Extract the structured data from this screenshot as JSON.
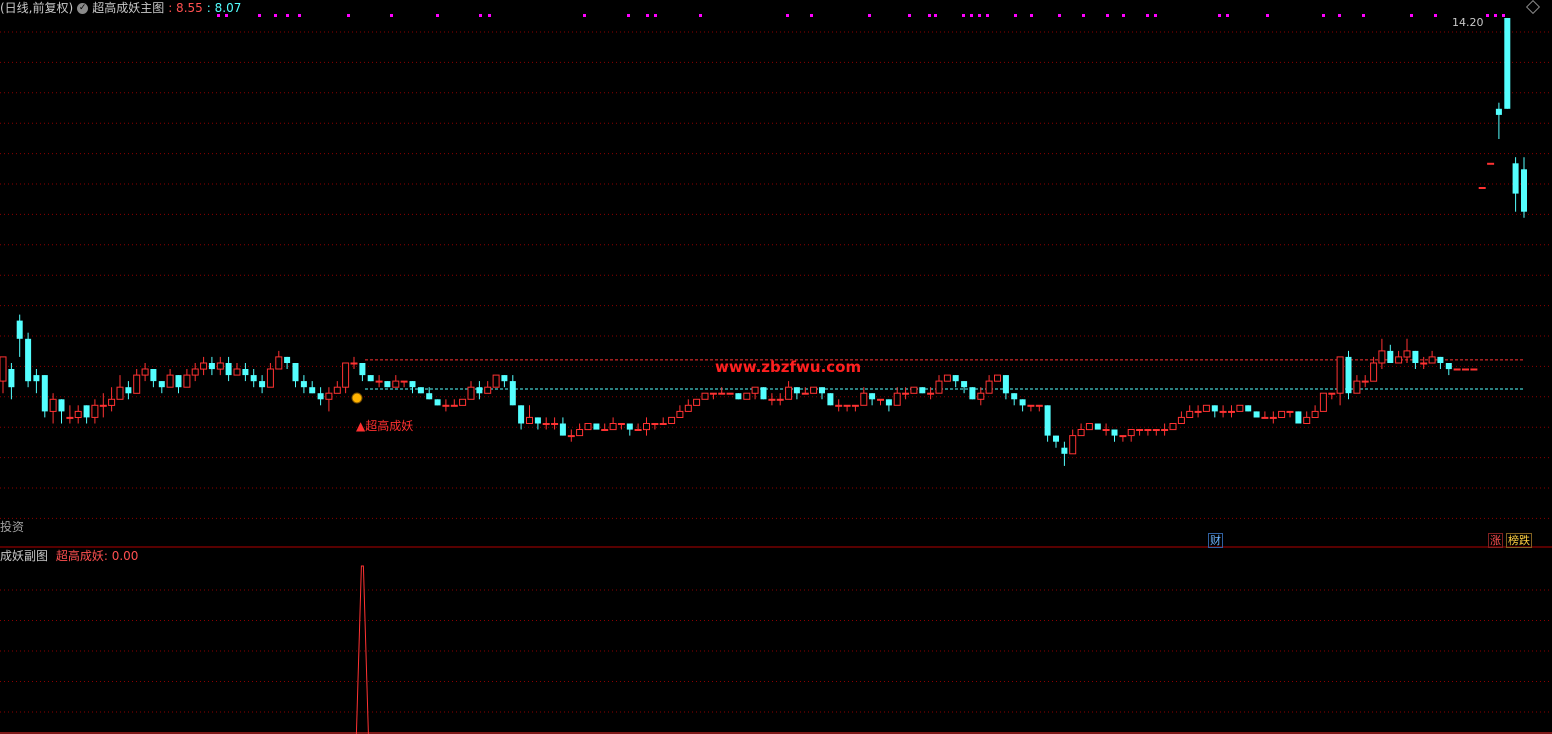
{
  "header": {
    "period_label": "(日线,前复权)",
    "main_name": "超高成妖主图",
    "value_a": ": 8.55",
    "value_b": ": 8.07"
  },
  "sub_header": {
    "name": "成妖副图",
    "indicator_label": "超高成妖",
    "indicator_value": ": 0.00"
  },
  "labels": {
    "price_high": "14.20",
    "watermark": "www.zbzfwu.com",
    "signal": "▲超高成妖",
    "left_text": "投资",
    "cai": "财",
    "zhang": "涨",
    "bang_die": "榜跌"
  },
  "colors": {
    "up": "#ff3232",
    "down": "#54ffff",
    "grid": "#8b0000",
    "magenta": "#ff00ff",
    "watermark": "#ff2020",
    "signal": "#ff3030"
  },
  "chart_data": {
    "type": "candlestick",
    "note_series": "ohlc price units",
    "candles": [
      [
        8.2,
        8.6,
        8.0,
        8.4
      ],
      [
        8.4,
        8.1,
        7.9,
        8.5
      ],
      [
        9.2,
        8.9,
        8.6,
        9.3
      ],
      [
        8.9,
        8.2,
        8.1,
        9.0
      ],
      [
        8.3,
        8.2,
        8.0,
        8.4
      ],
      [
        8.3,
        7.7,
        7.6,
        8.3
      ],
      [
        7.7,
        7.9,
        7.5,
        8.0
      ],
      [
        7.9,
        7.7,
        7.5,
        7.9
      ],
      [
        7.6,
        7.6,
        7.5,
        7.8
      ],
      [
        7.6,
        7.7,
        7.5,
        7.8
      ],
      [
        7.8,
        7.6,
        7.5,
        7.8
      ],
      [
        7.6,
        7.8,
        7.5,
        7.9
      ],
      [
        7.8,
        7.8,
        7.6,
        8.0
      ],
      [
        7.8,
        7.9,
        7.7,
        8.1
      ],
      [
        7.9,
        8.1,
        7.9,
        8.3
      ],
      [
        8.1,
        8.0,
        7.9,
        8.2
      ],
      [
        8.0,
        8.3,
        8.0,
        8.4
      ],
      [
        8.3,
        8.4,
        8.2,
        8.5
      ],
      [
        8.4,
        8.2,
        8.1,
        8.4
      ],
      [
        8.2,
        8.1,
        8.0,
        8.2
      ],
      [
        8.1,
        8.3,
        8.1,
        8.4
      ],
      [
        8.3,
        8.1,
        8.0,
        8.3
      ],
      [
        8.1,
        8.3,
        8.1,
        8.4
      ],
      [
        8.3,
        8.4,
        8.2,
        8.5
      ],
      [
        8.4,
        8.5,
        8.3,
        8.6
      ],
      [
        8.5,
        8.4,
        8.3,
        8.6
      ],
      [
        8.4,
        8.5,
        8.3,
        8.6
      ],
      [
        8.5,
        8.3,
        8.2,
        8.6
      ],
      [
        8.3,
        8.4,
        8.3,
        8.5
      ],
      [
        8.4,
        8.3,
        8.2,
        8.5
      ],
      [
        8.3,
        8.2,
        8.1,
        8.4
      ],
      [
        8.2,
        8.1,
        8.0,
        8.3
      ],
      [
        8.1,
        8.4,
        8.1,
        8.5
      ],
      [
        8.4,
        8.6,
        8.4,
        8.7
      ],
      [
        8.6,
        8.5,
        8.4,
        8.6
      ],
      [
        8.5,
        8.2,
        8.1,
        8.5
      ],
      [
        8.2,
        8.1,
        8.0,
        8.3
      ],
      [
        8.1,
        8.0,
        8.0,
        8.2
      ],
      [
        8.0,
        7.9,
        7.8,
        8.1
      ],
      [
        7.9,
        8.0,
        7.7,
        8.1
      ],
      [
        8.0,
        8.1,
        8.0,
        8.2
      ],
      [
        8.1,
        8.5,
        8.0,
        8.5
      ],
      [
        8.5,
        8.5,
        8.4,
        8.6
      ],
      [
        8.5,
        8.3,
        8.2,
        8.5
      ],
      [
        8.3,
        8.2,
        8.2,
        8.3
      ],
      [
        8.2,
        8.2,
        8.1,
        8.3
      ],
      [
        8.2,
        8.1,
        8.1,
        8.2
      ],
      [
        8.1,
        8.2,
        8.1,
        8.3
      ],
      [
        8.2,
        8.2,
        8.1,
        8.2
      ],
      [
        8.2,
        8.1,
        8.0,
        8.2
      ],
      [
        8.1,
        8.0,
        8.0,
        8.1
      ],
      [
        8.0,
        7.9,
        7.9,
        8.1
      ],
      [
        7.9,
        7.8,
        7.8,
        7.9
      ],
      [
        7.8,
        7.8,
        7.7,
        7.9
      ],
      [
        7.8,
        7.8,
        7.8,
        7.9
      ],
      [
        7.8,
        7.9,
        7.8,
        7.9
      ],
      [
        7.9,
        8.1,
        7.9,
        8.2
      ],
      [
        8.1,
        8.0,
        7.9,
        8.2
      ],
      [
        8.0,
        8.1,
        8.0,
        8.2
      ],
      [
        8.1,
        8.3,
        8.1,
        8.3
      ],
      [
        8.3,
        8.2,
        8.1,
        8.3
      ],
      [
        8.2,
        7.8,
        7.8,
        8.3
      ],
      [
        7.8,
        7.5,
        7.4,
        7.8
      ],
      [
        7.5,
        7.6,
        7.5,
        7.8
      ],
      [
        7.6,
        7.5,
        7.4,
        7.6
      ],
      [
        7.5,
        7.5,
        7.4,
        7.6
      ],
      [
        7.5,
        7.5,
        7.4,
        7.6
      ],
      [
        7.5,
        7.3,
        7.3,
        7.6
      ],
      [
        7.3,
        7.3,
        7.2,
        7.4
      ],
      [
        7.3,
        7.4,
        7.3,
        7.5
      ],
      [
        7.4,
        7.5,
        7.4,
        7.5
      ],
      [
        7.5,
        7.4,
        7.4,
        7.5
      ],
      [
        7.4,
        7.4,
        7.4,
        7.5
      ],
      [
        7.4,
        7.5,
        7.4,
        7.6
      ],
      [
        7.5,
        7.5,
        7.4,
        7.5
      ],
      [
        7.5,
        7.4,
        7.3,
        7.5
      ],
      [
        7.4,
        7.4,
        7.4,
        7.5
      ],
      [
        7.4,
        7.5,
        7.3,
        7.6
      ],
      [
        7.5,
        7.5,
        7.4,
        7.5
      ],
      [
        7.5,
        7.5,
        7.5,
        7.6
      ],
      [
        7.5,
        7.6,
        7.5,
        7.6
      ],
      [
        7.6,
        7.7,
        7.6,
        7.8
      ],
      [
        7.7,
        7.8,
        7.7,
        7.9
      ],
      [
        7.8,
        7.9,
        7.8,
        7.9
      ],
      [
        7.9,
        8.0,
        7.9,
        8.0
      ],
      [
        8.0,
        8.0,
        7.9,
        8.0
      ],
      [
        8.0,
        8.0,
        8.0,
        8.1
      ],
      [
        8.0,
        8.0,
        8.0,
        8.0
      ],
      [
        8.0,
        7.9,
        7.9,
        8.0
      ],
      [
        7.9,
        8.0,
        7.9,
        8.0
      ],
      [
        8.0,
        8.1,
        7.9,
        8.1
      ],
      [
        8.1,
        7.9,
        7.9,
        8.1
      ],
      [
        7.9,
        7.9,
        7.8,
        8.0
      ],
      [
        7.9,
        7.9,
        7.8,
        8.0
      ],
      [
        7.9,
        8.1,
        7.9,
        8.2
      ],
      [
        8.1,
        8.0,
        7.9,
        8.1
      ],
      [
        8.0,
        8.0,
        8.0,
        8.1
      ],
      [
        8.0,
        8.1,
        8.0,
        8.1
      ],
      [
        8.1,
        8.0,
        7.9,
        8.1
      ],
      [
        8.0,
        7.8,
        7.8,
        8.0
      ],
      [
        7.8,
        7.8,
        7.7,
        7.9
      ],
      [
        7.8,
        7.8,
        7.7,
        7.8
      ],
      [
        7.8,
        7.8,
        7.7,
        7.8
      ],
      [
        7.8,
        8.0,
        7.8,
        8.1
      ],
      [
        8.0,
        7.9,
        7.8,
        8.0
      ],
      [
        7.9,
        7.9,
        7.8,
        7.9
      ],
      [
        7.9,
        7.8,
        7.7,
        7.9
      ],
      [
        7.8,
        8.0,
        7.8,
        8.1
      ],
      [
        8.0,
        8.0,
        7.9,
        8.1
      ],
      [
        8.0,
        8.1,
        8.0,
        8.1
      ],
      [
        8.1,
        8.0,
        8.0,
        8.1
      ],
      [
        8.0,
        8.0,
        7.9,
        8.1
      ],
      [
        8.0,
        8.2,
        8.0,
        8.3
      ],
      [
        8.2,
        8.3,
        8.2,
        8.3
      ],
      [
        8.3,
        8.2,
        8.1,
        8.3
      ],
      [
        8.2,
        8.1,
        8.0,
        8.2
      ],
      [
        8.1,
        7.9,
        7.9,
        8.1
      ],
      [
        7.9,
        8.0,
        7.8,
        8.1
      ],
      [
        8.0,
        8.2,
        8.0,
        8.3
      ],
      [
        8.2,
        8.3,
        8.2,
        8.3
      ],
      [
        8.3,
        8.0,
        7.9,
        8.3
      ],
      [
        8.0,
        7.9,
        7.8,
        8.0
      ],
      [
        7.9,
        7.8,
        7.7,
        7.9
      ],
      [
        7.8,
        7.8,
        7.7,
        7.8
      ],
      [
        7.8,
        7.8,
        7.7,
        7.8
      ],
      [
        7.8,
        7.3,
        7.2,
        7.8
      ],
      [
        7.3,
        7.2,
        7.1,
        7.3
      ],
      [
        7.1,
        7.0,
        6.8,
        7.2
      ],
      [
        7.0,
        7.3,
        7.0,
        7.4
      ],
      [
        7.3,
        7.4,
        7.3,
        7.5
      ],
      [
        7.4,
        7.5,
        7.4,
        7.5
      ],
      [
        7.5,
        7.4,
        7.4,
        7.5
      ],
      [
        7.4,
        7.4,
        7.3,
        7.5
      ],
      [
        7.4,
        7.3,
        7.2,
        7.4
      ],
      [
        7.3,
        7.3,
        7.2,
        7.3
      ],
      [
        7.3,
        7.4,
        7.2,
        7.4
      ],
      [
        7.4,
        7.4,
        7.3,
        7.4
      ],
      [
        7.4,
        7.4,
        7.3,
        7.4
      ],
      [
        7.4,
        7.4,
        7.3,
        7.4
      ],
      [
        7.4,
        7.4,
        7.3,
        7.5
      ],
      [
        7.4,
        7.5,
        7.4,
        7.5
      ],
      [
        7.5,
        7.6,
        7.5,
        7.7
      ],
      [
        7.6,
        7.7,
        7.6,
        7.8
      ],
      [
        7.7,
        7.7,
        7.6,
        7.8
      ],
      [
        7.7,
        7.8,
        7.7,
        7.8
      ],
      [
        7.8,
        7.7,
        7.6,
        7.8
      ],
      [
        7.7,
        7.7,
        7.6,
        7.8
      ],
      [
        7.7,
        7.7,
        7.6,
        7.8
      ],
      [
        7.7,
        7.8,
        7.7,
        7.8
      ],
      [
        7.8,
        7.7,
        7.7,
        7.8
      ],
      [
        7.7,
        7.6,
        7.6,
        7.7
      ],
      [
        7.6,
        7.6,
        7.6,
        7.7
      ],
      [
        7.6,
        7.6,
        7.5,
        7.7
      ],
      [
        7.6,
        7.7,
        7.6,
        7.7
      ],
      [
        7.7,
        7.7,
        7.6,
        7.7
      ],
      [
        7.7,
        7.5,
        7.5,
        7.7
      ],
      [
        7.5,
        7.6,
        7.5,
        7.7
      ],
      [
        7.6,
        7.7,
        7.6,
        7.8
      ],
      [
        7.7,
        8.0,
        7.7,
        8.0
      ],
      [
        8.0,
        8.0,
        7.9,
        8.0
      ],
      [
        8.0,
        8.6,
        7.8,
        8.6
      ],
      [
        8.6,
        8.0,
        7.9,
        8.7
      ],
      [
        8.0,
        8.2,
        8.0,
        8.3
      ],
      [
        8.2,
        8.2,
        8.1,
        8.3
      ],
      [
        8.2,
        8.5,
        8.2,
        8.6
      ],
      [
        8.5,
        8.7,
        8.4,
        8.9
      ],
      [
        8.7,
        8.5,
        8.5,
        8.8
      ],
      [
        8.5,
        8.6,
        8.5,
        8.7
      ],
      [
        8.6,
        8.7,
        8.5,
        8.9
      ],
      [
        8.7,
        8.5,
        8.4,
        8.7
      ],
      [
        8.5,
        8.5,
        8.4,
        8.6
      ],
      [
        8.5,
        8.6,
        8.5,
        8.7
      ],
      [
        8.6,
        8.5,
        8.4,
        8.6
      ],
      [
        8.5,
        8.4,
        8.3,
        8.5
      ],
      [
        8.4,
        8.4,
        8.4,
        8.4
      ],
      [
        8.4,
        8.4,
        8.4,
        8.4
      ],
      [
        8.4,
        8.4,
        8.4,
        8.4
      ],
      [
        11.4,
        11.4,
        11.4,
        11.4
      ],
      [
        11.8,
        11.8,
        11.8,
        11.8
      ],
      [
        12.7,
        12.6,
        12.2,
        12.8
      ],
      [
        14.2,
        12.7,
        12.7,
        14.2
      ],
      [
        11.8,
        11.3,
        11.0,
        11.9
      ],
      [
        11.7,
        11.0,
        10.9,
        11.9
      ]
    ],
    "price_high": 14.2,
    "watermark_text": "www.zbzfwu.com",
    "reference_lines": [
      8.55,
      8.07
    ],
    "sub_indicator": {
      "name": "超高成妖",
      "spike_at_index": 43,
      "value": 0.0
    }
  }
}
